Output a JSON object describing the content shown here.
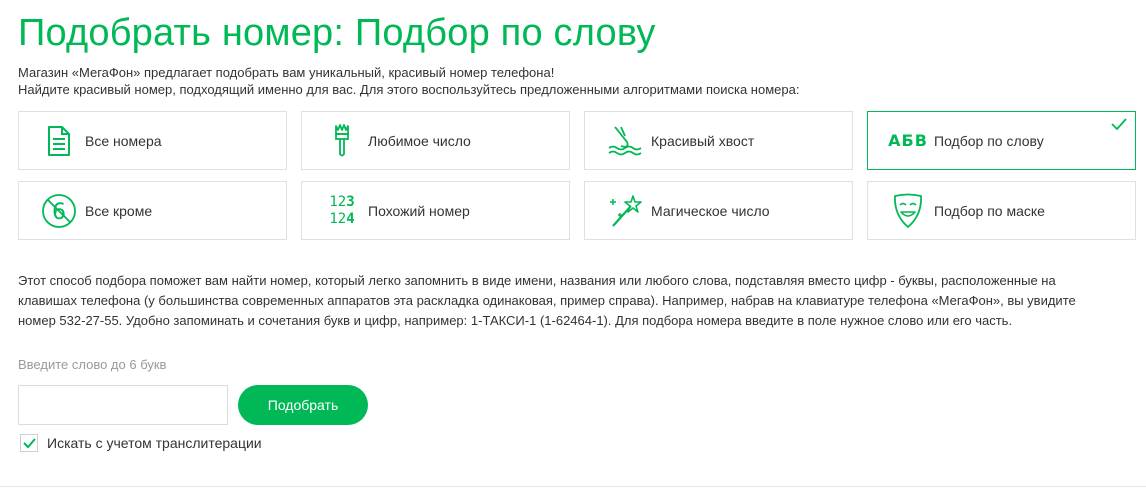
{
  "page": {
    "title": "Подобрать номер: Подбор по слову",
    "intro_line1": "Магазин «МегаФон» предлагает подобрать вам уникальный, красивый номер телефона!",
    "intro_line2": "Найдите красивый номер, подходящий именно для вас. Для этого воспользуйтесь предложенными алгоритмами поиска номера:"
  },
  "colors": {
    "accent": "#00b956",
    "border": "#e0e0e0",
    "text": "#333333",
    "hint": "#999999"
  },
  "tiles": [
    {
      "label": "Все номера",
      "icon": "document-icon",
      "active": false
    },
    {
      "label": "Любимое число",
      "icon": "brush-icon",
      "active": false
    },
    {
      "label": "Красивый хвост",
      "icon": "tail-icon",
      "active": false
    },
    {
      "label": "Подбор по слову",
      "icon": "abv-letters-icon",
      "icon_text": "АБВ",
      "active": true
    },
    {
      "label": "Все кроме",
      "icon": "no-six-icon",
      "icon_text": "6",
      "active": false
    },
    {
      "label": "Похожий номер",
      "icon": "similar-digits-icon",
      "icon_lines": [
        "123",
        "124"
      ],
      "active": false
    },
    {
      "label": "Магическое число",
      "icon": "magic-wand-icon",
      "active": false
    },
    {
      "label": "Подбор по маске",
      "icon": "mask-icon",
      "active": false
    }
  ],
  "description": "Этот способ подбора поможет вам найти номер, который легко запомнить в виде имени, названия или любого слова, подставляя вместо цифр - буквы, расположенные на клавишах телефона (у большинства современных аппаратов эта раскладка одинаковая, пример справа). Например, набрав на клавиатуре телефона «МегаФон», вы увидите номер 532-27-55. Удобно запоминать и сочетания букв и цифр, например: 1-ТАКСИ-1 (1-62464-1). Для подбора номера введите в поле нужное слово или его часть.",
  "form": {
    "hint": "Введите слово до 6 букв",
    "input_value": "",
    "submit_label": "Подобрать",
    "checkbox_label": "Искать с учетом транслитерации",
    "checkbox_checked": true
  }
}
